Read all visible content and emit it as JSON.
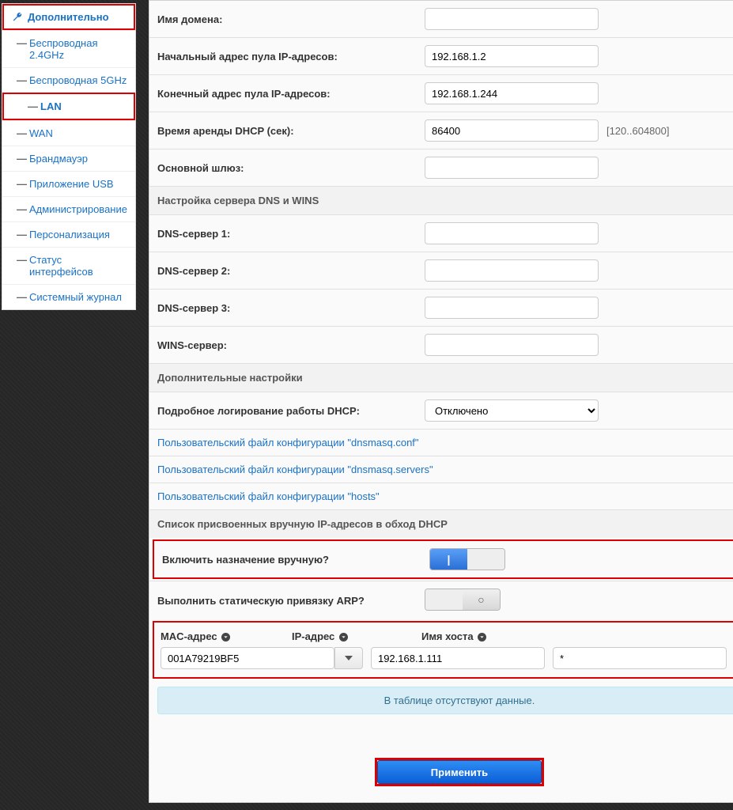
{
  "sidebar": {
    "header": "Дополнительно",
    "items": [
      {
        "label": "Беспроводная 2.4GHz"
      },
      {
        "label": "Беспроводная 5GHz"
      },
      {
        "label": "LAN"
      },
      {
        "label": "WAN"
      },
      {
        "label": "Брандмауэр"
      },
      {
        "label": "Приложение USB"
      },
      {
        "label": "Администрирование"
      },
      {
        "label": "Персонализация"
      },
      {
        "label": "Статус интерфейсов"
      },
      {
        "label": "Системный журнал"
      }
    ]
  },
  "form": {
    "domain_label": "Имя домена:",
    "domain_value": "",
    "pool_start_label": "Начальный адрес пула IP-адресов:",
    "pool_start_value": "192.168.1.2",
    "pool_end_label": "Конечный адрес пула IP-адресов:",
    "pool_end_value": "192.168.1.244",
    "lease_label": "Время аренды DHCP (сек):",
    "lease_value": "86400",
    "lease_hint": "[120..604800]",
    "gateway_label": "Основной шлюз:",
    "gateway_value": "",
    "dns_section": "Настройка сервера DNS и WINS",
    "dns1_label": "DNS-сервер 1:",
    "dns1_value": "",
    "dns2_label": "DNS-сервер 2:",
    "dns2_value": "",
    "dns3_label": "DNS-сервер 3:",
    "dns3_value": "",
    "wins_label": "WINS-сервер:",
    "wins_value": "",
    "extra_section": "Дополнительные настройки",
    "logging_label": "Подробное логирование работы DHCP:",
    "logging_value": "Отключено",
    "link1": "Пользовательский файл конфигурации \"dnsmasq.conf\"",
    "link2": "Пользовательский файл конфигурации \"dnsmasq.servers\"",
    "link3": "Пользовательский файл конфигурации \"hosts\"",
    "manual_section": "Список присвоенных вручную IP-адресов в обход DHCP",
    "manual_enable_label": "Включить назначение вручную?",
    "arp_label": "Выполнить статическую привязку ARP?",
    "th_mac": "MAC-адрес",
    "th_ip": "IP-адрес",
    "th_host": "Имя хоста",
    "mac_value": "001A79219BF5",
    "ip_value": "192.168.1.111",
    "host_value": "*",
    "empty_msg": "В таблице отсутствуют данные.",
    "apply": "Применить"
  }
}
